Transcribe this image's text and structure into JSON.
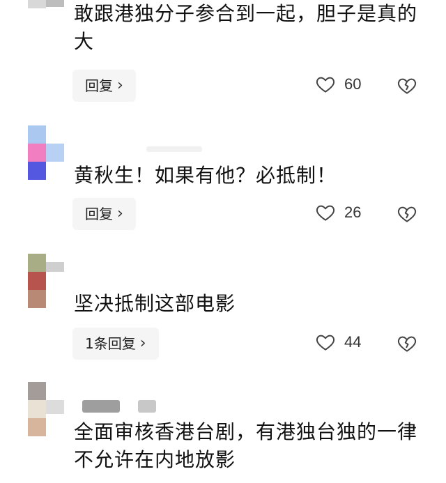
{
  "comments": [
    {
      "text": "敢跟港独分子参合到一起，胆子是真的大",
      "reply_label": "回复",
      "likes": "60"
    },
    {
      "text": "黄秋生！如果有他？必抵制！",
      "reply_label": "回复",
      "likes": "26"
    },
    {
      "text": "坚决抵制这部电影",
      "reply_label": "1条回复",
      "likes": "44"
    },
    {
      "text": "全面审核香港台剧，有港独台独的一律不允许在内地放影",
      "reply_label": "",
      "likes": ""
    }
  ],
  "icons": {
    "like": "heart-icon",
    "dislike": "broken-heart-icon",
    "reply_arrow": "chevron-right-icon"
  },
  "colors": {
    "text": "#111111",
    "reply_bg": "#f5f5f5",
    "icon": "#333333"
  }
}
